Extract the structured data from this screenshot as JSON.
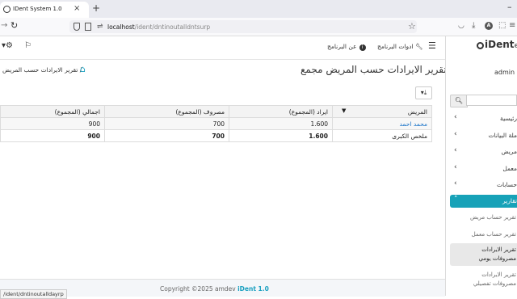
{
  "browser": {
    "tab_title": "IDent System 1.0",
    "url_host": "localhost",
    "url_path": "/ident/dntinoutalldntsurp",
    "status_url": "/ident/dntinoutalldayrp"
  },
  "header": {
    "about": "عن البرنامج",
    "tools": "ادوات البرنامج"
  },
  "page": {
    "title": "تقرير الايرادات حسب المريض مجمع",
    "breadcrumb": "تقرير الايرادات حسب المريض",
    "breadcrumb_sep": "/"
  },
  "table": {
    "headers": [
      "اجمالي (المجموع)",
      "مصروف (المجموع)",
      "ايراد (المجموع)",
      "المريض"
    ],
    "rows": [
      [
        "900",
        "700",
        "1.600",
        "محمد احمد"
      ]
    ],
    "footer": [
      "900",
      "700",
      "1.600",
      "ملخص الكبرى"
    ]
  },
  "footer": {
    "copyright": "Copyright ©2025 amdev",
    "product": "iDent 1.0"
  },
  "sidebar": {
    "logo": "iDent",
    "logo_suffix": "ev",
    "user": "admin",
    "items": [
      {
        "label": "رئيسية"
      },
      {
        "label": "ملة البيانات"
      },
      {
        "label": "مريض"
      },
      {
        "label": "معمل"
      },
      {
        "label": "حسابات"
      },
      {
        "label": "تقارير"
      }
    ],
    "subitems": [
      {
        "label": "تقرير حساب مريض"
      },
      {
        "label": "تقرير حساب معمل"
      },
      {
        "label_1": "تقرير الايرادات",
        "label_2": "مصروفات يومي"
      },
      {
        "label_1": "تقرير الايرادات",
        "label_2": "مصروفات تفصيلي"
      }
    ]
  },
  "colors": {
    "accent": "#17a2b8"
  }
}
